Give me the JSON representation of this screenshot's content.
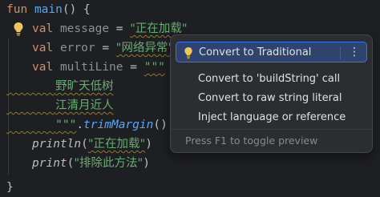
{
  "editor": {
    "lines": {
      "l1": {
        "kw": "fun",
        "name": "main",
        "rest": "() {"
      },
      "l2": {
        "kw": "val",
        "name": "message",
        "eq": " = ",
        "str": "\"正在加载\""
      },
      "l3": {
        "kw": "val",
        "name": "error",
        "eq": " = ",
        "str": "\"网络异常\""
      },
      "l4": {
        "kw": "val",
        "name": "multiLine",
        "eq": " = ",
        "str": "\"\"\""
      },
      "l5": {
        "str": "野旷天低树"
      },
      "l6": {
        "str": "江清月近人"
      },
      "l7": {
        "str": "\"\"\"",
        "dot": ".",
        "method": "trimMargin",
        "rest": "()"
      },
      "l8": {
        "call": "println",
        "open": "(",
        "str": "\"正在加载\"",
        "close": ")"
      },
      "l9": {
        "call": "print",
        "open": "(",
        "str": "\"排除此方法\"",
        "close": ")"
      },
      "l10": {
        "rest": "}"
      }
    }
  },
  "popup": {
    "items": [
      {
        "label": "Convert to Traditional"
      },
      {
        "label": "Convert to 'buildString' call"
      },
      {
        "label": "Convert to raw string literal"
      },
      {
        "label": "Inject language or reference"
      }
    ],
    "more_icon": "⋮",
    "footer": "Press F1 to toggle preview"
  },
  "colors": {
    "keyword": "#cf8e6d",
    "function": "#56a8f5",
    "string": "#6aab73",
    "selection": "#2e436e",
    "accent": "#3574f0",
    "bulb": "#f2c55c"
  }
}
